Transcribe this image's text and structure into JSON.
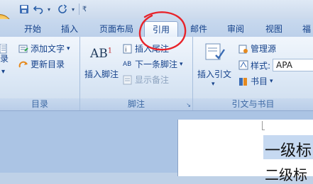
{
  "tabs": [
    {
      "label": "开始",
      "active": false
    },
    {
      "label": "插入",
      "active": false
    },
    {
      "label": "页面布局",
      "active": false
    },
    {
      "label": "引用",
      "active": true
    },
    {
      "label": "邮件",
      "active": false
    },
    {
      "label": "审阅",
      "active": false
    },
    {
      "label": "视图",
      "active": false
    },
    {
      "label": "福",
      "active": false
    }
  ],
  "groups": {
    "toc": {
      "label": "目录",
      "add_text": "添加文字",
      "update_toc": "更新目录",
      "toc_partial": "录"
    },
    "footnotes": {
      "label": "脚注",
      "insert_footnote": "插入脚注",
      "ab_glyph": "AB",
      "ab_super": "1",
      "insert_endnote": "插入尾注",
      "next_footnote": "下一条脚注",
      "show_notes": "显示备注"
    },
    "citations": {
      "label": "引文与书目",
      "insert_citation": "插入引文",
      "manage_sources": "管理源",
      "style_label": "样式:",
      "style_value": "APA",
      "bibliography": "书目"
    }
  },
  "document": {
    "heading1": "一级标",
    "heading2": "二级标"
  },
  "icons": {
    "save": "save-icon",
    "undo": "undo-icon",
    "redo": "redo-icon"
  },
  "colors": {
    "annotation": "#e8232a",
    "ribbon_text": "#15428b"
  }
}
